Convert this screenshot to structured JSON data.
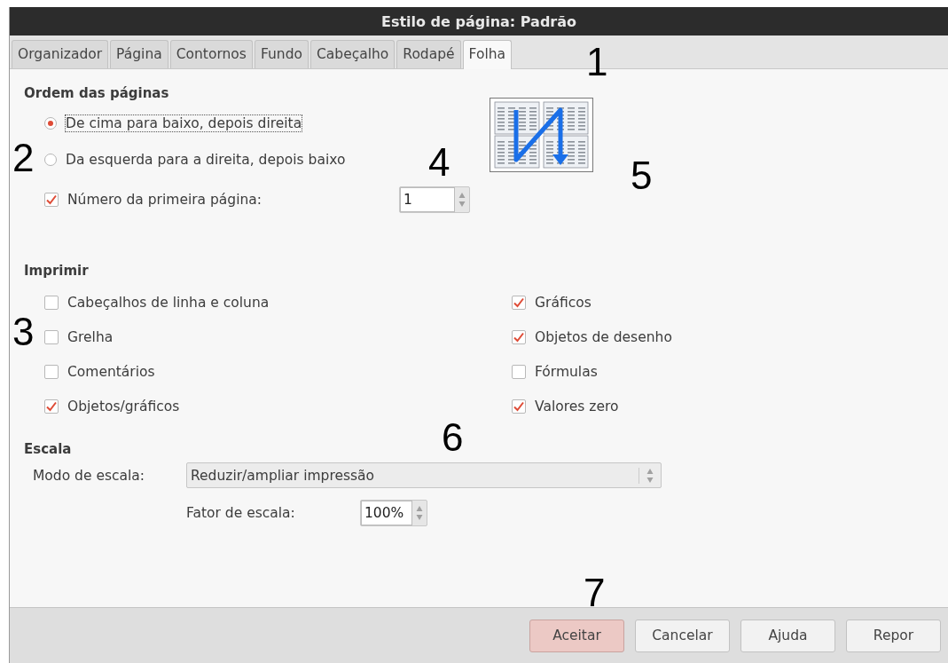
{
  "window": {
    "title": "Estilo de página: Padrão"
  },
  "tabs": [
    {
      "label": "Organizador",
      "selected": false
    },
    {
      "label": "Página",
      "selected": false
    },
    {
      "label": "Contornos",
      "selected": false
    },
    {
      "label": "Fundo",
      "selected": false
    },
    {
      "label": "Cabeçalho",
      "selected": false
    },
    {
      "label": "Rodapé",
      "selected": false
    },
    {
      "label": "Folha",
      "selected": true
    }
  ],
  "page_order": {
    "heading": "Ordem das páginas",
    "options": [
      {
        "label": "De cima para baixo, depois direita",
        "selected": true
      },
      {
        "label": "Da esquerda para a direita, depois baixo",
        "selected": false
      }
    ],
    "first_page": {
      "label": "Número da primeira página:",
      "checked": true,
      "value": "1"
    }
  },
  "print": {
    "heading": "Imprimir",
    "items": [
      {
        "label": "Cabeçalhos de linha e coluna",
        "checked": false
      },
      {
        "label": "Gráficos",
        "checked": true
      },
      {
        "label": "Grelha",
        "checked": false
      },
      {
        "label": "Objetos de desenho",
        "checked": true
      },
      {
        "label": "Comentários",
        "checked": false
      },
      {
        "label": "Fórmulas",
        "checked": false
      },
      {
        "label": "Objetos/gráficos",
        "checked": true
      },
      {
        "label": "Valores zero",
        "checked": true
      }
    ]
  },
  "scale": {
    "heading": "Escala",
    "mode_label": "Modo de escala:",
    "mode_value": "Reduzir/ampliar impressão",
    "factor_label": "Fator de escala:",
    "factor_value": "100%"
  },
  "buttons": [
    {
      "label": "Aceitar",
      "kind": "default"
    },
    {
      "label": "Cancelar",
      "kind": "normal"
    },
    {
      "label": "Ajuda",
      "kind": "normal"
    },
    {
      "label": "Repor",
      "kind": "normal"
    }
  ],
  "callouts": [
    "1",
    "2",
    "3",
    "4",
    "5",
    "6",
    "7"
  ]
}
